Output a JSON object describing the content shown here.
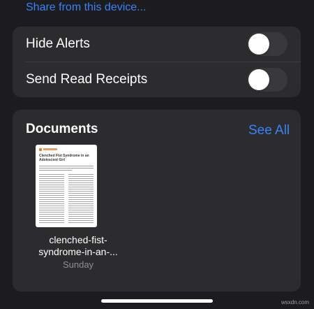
{
  "share_link": "Share from this device...",
  "settings": {
    "items": [
      {
        "label": "Hide Alerts",
        "toggle_on": false
      },
      {
        "label": "Send Read Receipts",
        "toggle_on": false
      }
    ]
  },
  "documents": {
    "title": "Documents",
    "see_all": "See All",
    "items": [
      {
        "thumb_title": "Clenched Fist Syndrome in an Adolescent Girl",
        "name_line1": "clenched-fist-",
        "name_line2": "syndrome-in-an-...",
        "date": "Sunday"
      }
    ]
  },
  "watermark": "wsxdn.com",
  "colors": {
    "accent": "#3a82f7",
    "background": "#1c1c1e",
    "card": "#2c2c2e"
  }
}
